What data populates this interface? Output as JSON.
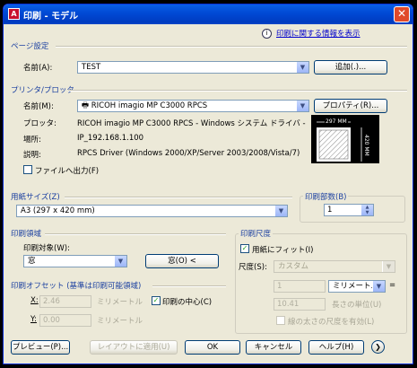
{
  "window": {
    "title": "印刷 - モデル",
    "app_icon": "A",
    "close": "✕"
  },
  "help_link": "印刷に関する情報を表示",
  "page_setup": {
    "title": "ページ設定",
    "name_label": "名前(A):",
    "name_value": "TEST",
    "add_button": "追加(.)..."
  },
  "printer": {
    "title": "プリンタ/プロッタ",
    "name_label": "名前(M):",
    "name_value": "RICOH imagio MP C3000 RPCS",
    "properties_button": "プロパティ(R)...",
    "plotter_label": "プロッタ:",
    "plotter_value": "RICOH imagio MP C3000 RPCS - Windows システム ドライバ - ...",
    "location_label": "場所:",
    "location_value": "IP_192.168.1.100",
    "description_label": "説明:",
    "description_value": "RPCS Driver (Windows 2000/XP/Server 2003/2008/Vista/7)",
    "file_output_label": "ファイルへ出力(F)",
    "file_output_checked": false,
    "preview_width": "297 MM",
    "preview_height": "420 MM"
  },
  "paper_size": {
    "title": "用紙サイズ(Z)",
    "value": "A3 (297 x 420 mm)"
  },
  "copies": {
    "title": "印刷部数(B)",
    "value": "1"
  },
  "print_area": {
    "title": "印刷領域",
    "target_label": "印刷対象(W):",
    "target_value": "窓",
    "window_button": "窓(O) <"
  },
  "print_scale": {
    "title": "印刷尺度",
    "fit_label": "用紙にフィット(I)",
    "fit_checked": true,
    "scale_label": "尺度(S):",
    "scale_value": "カスタム",
    "num_value": "1",
    "unit_value": "ミリメートル",
    "equals": "=",
    "units_value": "10.41",
    "units_label": "長さの単位(U)",
    "lineweight_label": "線の太さの尺度を有効(L)",
    "lineweight_checked": false
  },
  "offset": {
    "title": "印刷オフセット (基準は印刷可能領域)",
    "x_label": "X:",
    "x_value": "2.46",
    "x_unit": "ミリメートル",
    "y_label": "Y:",
    "y_value": "0.00",
    "y_unit": "ミリメートル",
    "center_label": "印刷の中心(C)",
    "center_checked": true
  },
  "footer": {
    "preview": "プレビュー(P)...",
    "apply": "レイアウトに適用(U)",
    "ok": "OK",
    "cancel": "キャンセル",
    "help": "ヘルプ(H)",
    "expand": "❯"
  }
}
